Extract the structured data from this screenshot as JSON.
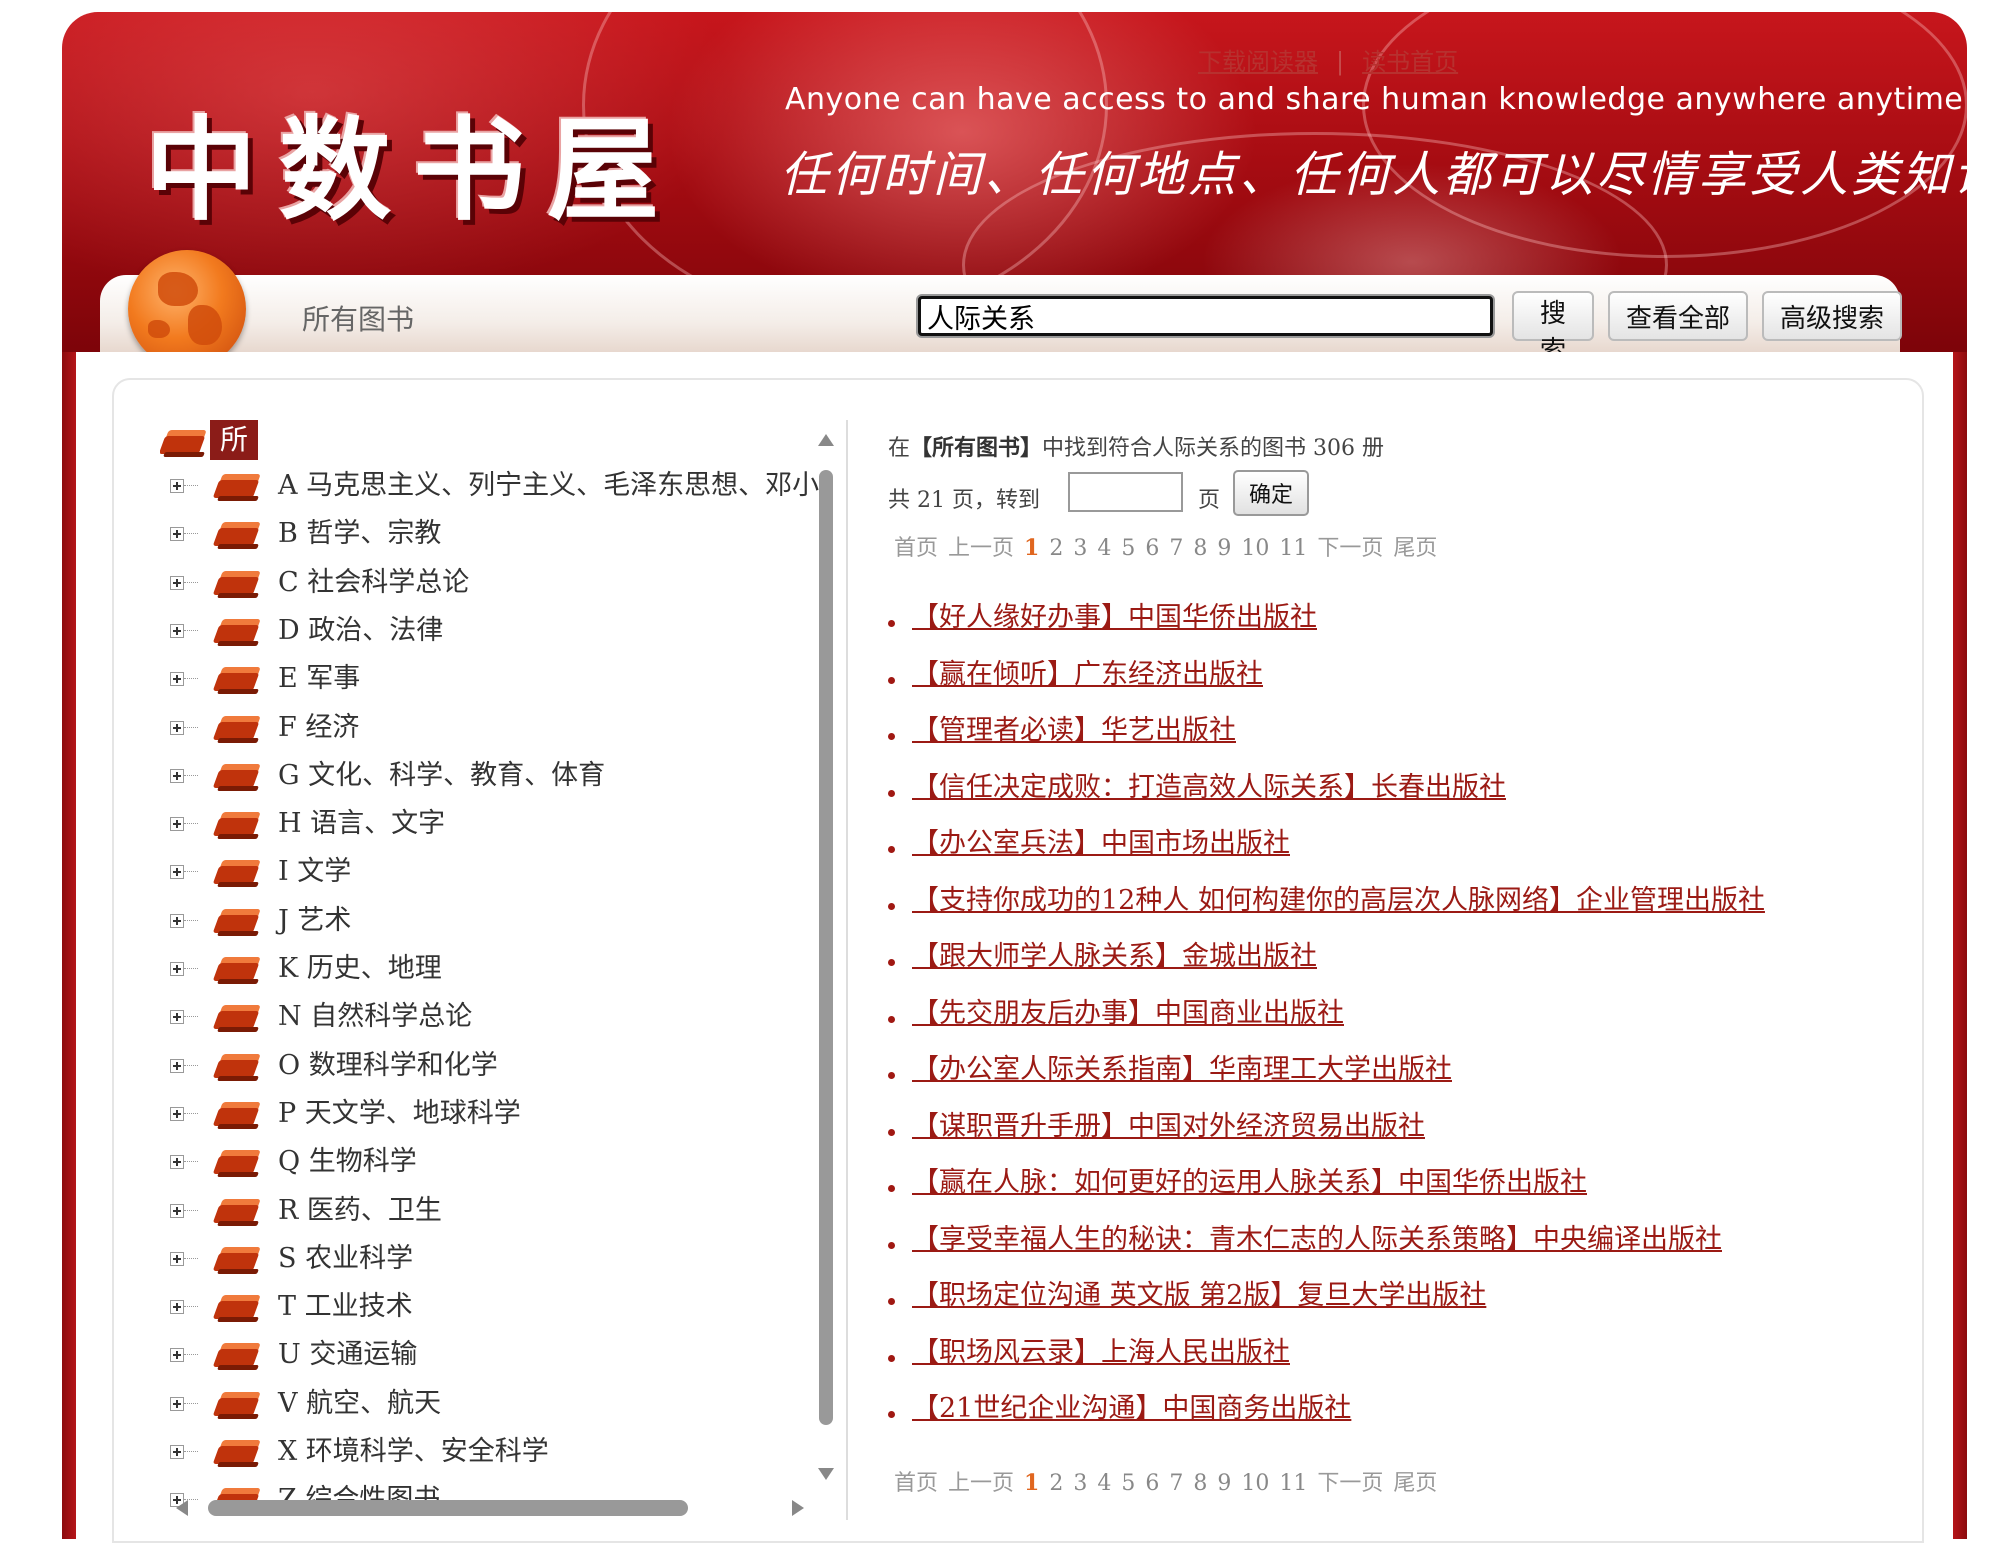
{
  "header": {
    "logo_text": "中数书屋",
    "slogan_en": "Anyone can have access to and share human knowledge anywhere anytime",
    "slogan_cn": "任何时间、任何地点、任何人都可以尽情享受人类知识",
    "links": [
      "下载阅读器",
      "读书首页"
    ]
  },
  "search": {
    "category_label": "所有图书",
    "query": "人际关系",
    "search_label": "搜索",
    "view_all_label": "查看全部",
    "advanced_label": "高级搜索"
  },
  "tree": {
    "root_label": "所有图书",
    "items": [
      {
        "label": "A 马克思主义、列宁主义、毛泽东思想、邓小平理论"
      },
      {
        "label": "B 哲学、宗教"
      },
      {
        "label": "C 社会科学总论"
      },
      {
        "label": "D 政治、法律"
      },
      {
        "label": "E 军事"
      },
      {
        "label": "F 经济"
      },
      {
        "label": "G 文化、科学、教育、体育"
      },
      {
        "label": "H 语言、文字"
      },
      {
        "label": "I 文学"
      },
      {
        "label": "J 艺术"
      },
      {
        "label": "K 历史、地理"
      },
      {
        "label": "N 自然科学总论"
      },
      {
        "label": "O 数理科学和化学"
      },
      {
        "label": "P 天文学、地球科学"
      },
      {
        "label": "Q 生物科学"
      },
      {
        "label": "R 医药、卫生"
      },
      {
        "label": "S 农业科学"
      },
      {
        "label": "T 工业技术"
      },
      {
        "label": "U 交通运输"
      },
      {
        "label": "V 航空、航天"
      },
      {
        "label": "X 环境科学、安全科学"
      },
      {
        "label": "Z 综合性图书"
      }
    ]
  },
  "results": {
    "summary_prefix": "在",
    "summary_category": "【所有图书】",
    "summary_mid": "中找到符合人际关系的图书",
    "summary_count": "306",
    "summary_unit": "册",
    "pages_text": "共 21 页，转到",
    "page_unit": "页",
    "confirm_label": "确定",
    "pager": {
      "first": "首页",
      "prev": "上一页",
      "current": "1",
      "pages": [
        "2",
        "3",
        "4",
        "5",
        "6",
        "7",
        "8",
        "9",
        "10",
        "11"
      ],
      "next": "下一页",
      "last": "尾页"
    },
    "books": [
      "【好人缘好办事】中国华侨出版社",
      "【赢在倾听】广东经济出版社",
      "【管理者必读】华艺出版社",
      "【信任决定成败：打造高效人际关系】长春出版社",
      "【办公室兵法】中国市场出版社",
      "【支持你成功的12种人 如何构建你的高层次人脉网络】企业管理出版社",
      "【跟大师学人脉关系】金城出版社",
      "【先交朋友后办事】中国商业出版社",
      "【办公室人际关系指南】华南理工大学出版社",
      "【谋职晋升手册】中国对外经济贸易出版社",
      "【赢在人脉：如何更好的运用人脉关系】中国华侨出版社",
      "【享受幸福人生的秘诀：青木仁志的人际关系策略】中央编译出版社",
      "【职场定位沟通 英文版 第2版】复旦大学出版社",
      "【职场风云录】上海人民出版社",
      "【21世纪企业沟通】中国商务出版社"
    ]
  }
}
